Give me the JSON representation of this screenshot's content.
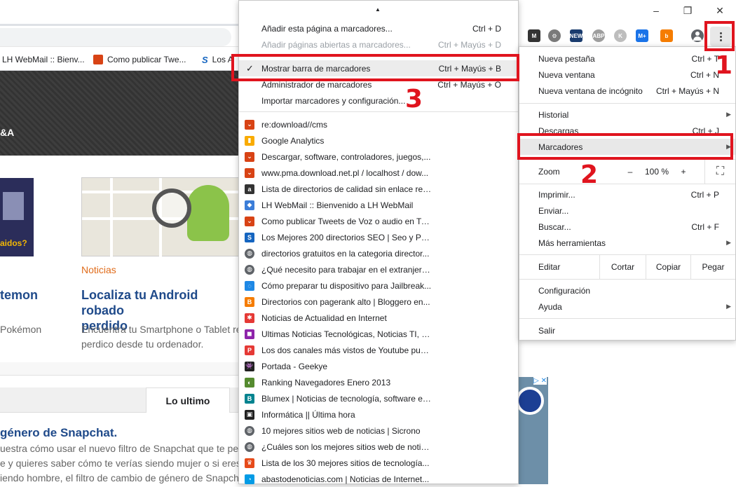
{
  "window": {
    "minimize": "–",
    "maximize": "❐",
    "close": "✕"
  },
  "bookmarks_bar": [
    {
      "label": "LH WebMail :: Bienv...",
      "icon": "lh-webmail-icon"
    },
    {
      "label": "Como publicar Twe...",
      "icon": "twitter-bookmark-icon"
    },
    {
      "label": "Los A",
      "icon": "seo-bookmark-icon"
    }
  ],
  "extensions": [
    {
      "name": "m-extension-icon",
      "text": "M",
      "color": "#333333"
    },
    {
      "name": "gear-extension-icon",
      "text": "⚙",
      "color": "#7a7a7a"
    },
    {
      "name": "news-extension-icon",
      "text": "NEW",
      "color": "#1a3c6e"
    },
    {
      "name": "abp-extension-icon",
      "text": "ABP",
      "color": "#9e9e9e"
    },
    {
      "name": "k-extension-icon",
      "text": "K",
      "color": "#bdbdbd"
    },
    {
      "name": "m-plus-extension-icon",
      "text": "M+",
      "color": "#1a73e8"
    },
    {
      "name": "b-extension-icon",
      "text": "b",
      "color": "#f57c00"
    }
  ],
  "site": {
    "header_text": "&A",
    "left_title": "temon",
    "left_desc": "Pokémon",
    "thumb_text": "aidos?",
    "article": {
      "category": "Noticias",
      "title_line1": "Localiza tu Android robado",
      "title_line2": "perdido",
      "desc_line1": "Encuentra tu Smartphone o Tablet re",
      "desc_line2": "perdico desde tu ordenador."
    },
    "tab_label": "Lo ultimo",
    "lower_title": "género de Snapchat.",
    "lower_lines": [
      "uestra cómo usar el nuevo filtro de Snapchat que te pe",
      "e y quieres saber cómo te verías siendo mujer o si eres",
      "iendo hombre, el filtro de cambio de género de Snapch"
    ]
  },
  "bookmarks_menu": {
    "scroll_up": "▲",
    "actions": [
      {
        "label": "Añadir esta página a marcadores...",
        "shortcut": "Ctrl + D",
        "enabled": true
      },
      {
        "label": "Añadir páginas abiertas a marcadores...",
        "shortcut": "Ctrl + Mayús + D",
        "enabled": false
      },
      {
        "label": "Mostrar barra de marcadores",
        "shortcut": "Ctrl + Mayús + B",
        "checked": "✓"
      },
      {
        "label": "Administrador de marcadores",
        "shortcut": "Ctrl + Mayús + O"
      },
      {
        "label": "Importar marcadores y configuración..."
      }
    ],
    "items": [
      {
        "label": "re:download//cms",
        "icon": "download-favicon-icon",
        "color": "#d84315",
        "glyph": "⌄"
      },
      {
        "label": "Google Analytics",
        "icon": "analytics-favicon-icon",
        "color": "#f9ab00",
        "glyph": "▮"
      },
      {
        "label": "Descargar, software, controladores, juegos,...",
        "icon": "download-favicon-icon",
        "color": "#d84315",
        "glyph": "⌄"
      },
      {
        "label": "www.pma.download.net.pl / localhost / dow...",
        "icon": "download-favicon-icon",
        "color": "#d84315",
        "glyph": "⌄"
      },
      {
        "label": "Lista de directorios de calidad sin enlace reci...",
        "icon": "a-favicon-icon",
        "color": "#333333",
        "glyph": "a"
      },
      {
        "label": "LH WebMail :: Bienvenido a LH WebMail",
        "icon": "webmail-favicon-icon",
        "color": "#3b7dd8",
        "glyph": "◆"
      },
      {
        "label": "Como publicar Tweets de Voz o audio en Tw...",
        "icon": "download-favicon-icon",
        "color": "#d84315",
        "glyph": "⌄"
      },
      {
        "label": "Los Mejores 200 directorios SEO | Seo y Posi...",
        "icon": "seo-favicon-icon",
        "color": "#1565c0",
        "glyph": "S"
      },
      {
        "label": "directorios gratuitos en la categoria director...",
        "icon": "globe-icon",
        "color": "#5f6368",
        "glyph": "◍"
      },
      {
        "label": "¿Qué necesito para trabajar en el extranjero...",
        "icon": "globe-icon",
        "color": "#5f6368",
        "glyph": "◍"
      },
      {
        "label": "Cómo preparar tu dispositivo para Jailbreak...",
        "icon": "chat-favicon-icon",
        "color": "#1e88e5",
        "glyph": "◌"
      },
      {
        "label": "Directorios con pagerank alto | Bloggero en...",
        "icon": "blogger-favicon-icon",
        "color": "#f57c00",
        "glyph": "B"
      },
      {
        "label": "Noticias de Actualidad en Internet",
        "icon": "news-favicon-icon",
        "color": "#e53935",
        "glyph": "✱"
      },
      {
        "label": "Ultimas Noticias Tecnológicas, Noticias TI, S...",
        "icon": "rainbow-favicon-icon",
        "color": "#8e24aa",
        "glyph": "◼"
      },
      {
        "label": "Los dos canales más vistos de Youtube publi...",
        "icon": "p-favicon-icon",
        "color": "#e53935",
        "glyph": "P"
      },
      {
        "label": "Portada - Geekye",
        "icon": "invader-favicon-icon",
        "color": "#212121",
        "glyph": "👾"
      },
      {
        "label": "Ranking Navegadores Enero 2013",
        "icon": "ranking-favicon-icon",
        "color": "#558b2f",
        "glyph": "◐"
      },
      {
        "label": "Blumex | Noticias de tecnología, software e i...",
        "icon": "blumex-favicon-icon",
        "color": "#00838f",
        "glyph": "B"
      },
      {
        "label": "Informática || Última hora",
        "icon": "info-favicon-icon",
        "color": "#212121",
        "glyph": "▣"
      },
      {
        "label": "10 mejores sitios web de noticias | Sicrono",
        "icon": "globe-icon",
        "color": "#5f6368",
        "glyph": "◍"
      },
      {
        "label": "¿Cuáles son los mejores sitios web de notici...",
        "icon": "globe-icon",
        "color": "#5f6368",
        "glyph": "◍"
      },
      {
        "label": "Lista de los 30 mejores sitios de tecnología...",
        "icon": "trophy-favicon-icon",
        "color": "#e64a19",
        "glyph": "♛"
      },
      {
        "label": "abastodenoticias.com | Noticias de Internet...",
        "icon": "abasto-favicon-icon",
        "color": "#039be5",
        "glyph": "◔"
      }
    ]
  },
  "main_menu": {
    "group1": [
      {
        "label": "Nueva pestaña",
        "shortcut": "Ctrl + T"
      },
      {
        "label": "Nueva ventana",
        "shortcut": "Ctrl + N"
      },
      {
        "label": "Nueva ventana de incógnito",
        "shortcut": "Ctrl + Mayús + N"
      }
    ],
    "group2": [
      {
        "label": "Historial",
        "arrow": "▶"
      },
      {
        "label": "Descargas",
        "shortcut": "Ctrl + J"
      },
      {
        "label": "Marcadores",
        "arrow": "▶"
      }
    ],
    "zoom": {
      "label": "Zoom",
      "minus": "–",
      "value": "100 %",
      "plus": "+",
      "fullscreen": "⛶"
    },
    "group3": [
      {
        "label": "Imprimir...",
        "shortcut": "Ctrl + P"
      },
      {
        "label": "Enviar..."
      },
      {
        "label": "Buscar...",
        "shortcut": "Ctrl + F"
      },
      {
        "label": "Más herramientas",
        "arrow": "▶"
      }
    ],
    "edit": {
      "label": "Editar",
      "cut": "Cortar",
      "copy": "Copiar",
      "paste": "Pegar"
    },
    "group4": [
      {
        "label": "Configuración"
      },
      {
        "label": "Ayuda",
        "arrow": "▶"
      }
    ],
    "exit": {
      "label": "Salir"
    }
  },
  "annotations": {
    "n1": "1",
    "n2": "2",
    "n3": "3",
    "color": "#e0141e"
  },
  "ad": {
    "badges": "▷ ✕"
  }
}
